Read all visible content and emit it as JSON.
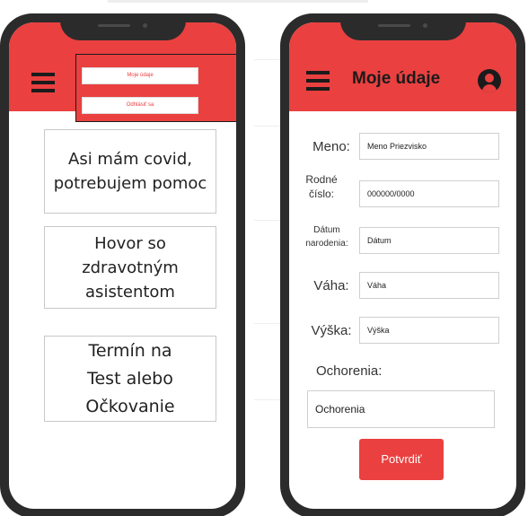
{
  "colors": {
    "accent": "#ea4040",
    "frame": "#2b2b2b",
    "icon": "#1b1b1b"
  },
  "icons": {
    "menu": "hamburger-menu-icon",
    "profile": "user-avatar-icon"
  },
  "left_screen": {
    "dropdown": {
      "my_data": "Moje údaje",
      "logout": "Odhlásiť sa"
    },
    "cards": [
      "Asi mám covid,\npotrebujem pomoc",
      "Hovor so\nzdravotným\nasistentom",
      "Termín na\nTest alebo\nOčkovanie"
    ]
  },
  "right_screen": {
    "title": "Moje údaje",
    "form": {
      "name": {
        "label": "Meno:",
        "value": "Meno Priezvisko"
      },
      "birth_number": {
        "label": "Rodné\nčíslo:",
        "value": "000000/0000"
      },
      "birth_date": {
        "label": "Dátum\nnarodenia:",
        "value": "Dátum"
      },
      "weight": {
        "label": "Váha:",
        "value": "Váha"
      },
      "height": {
        "label": "Výška:",
        "value": "Výška"
      },
      "illnesses": {
        "label": "Ochorenia:",
        "value": "Ochorenia"
      }
    },
    "submit": "Potvrdiť"
  }
}
